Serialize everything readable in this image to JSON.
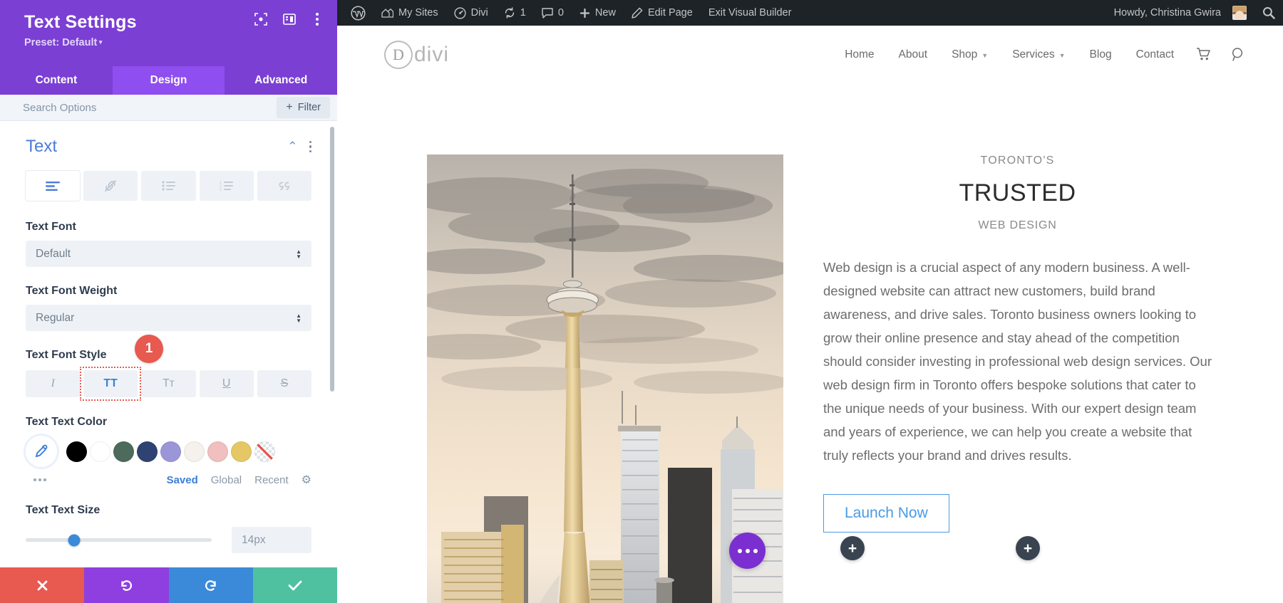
{
  "panel": {
    "title": "Text Settings",
    "preset_label": "Preset: Default",
    "header_icons": [
      "focus-frame-icon",
      "panel-layout-icon",
      "more-vertical-icon"
    ],
    "tabs": [
      {
        "label": "Content",
        "active": false
      },
      {
        "label": "Design",
        "active": true
      },
      {
        "label": "Advanced",
        "active": false
      }
    ],
    "search": {
      "placeholder": "Search Options",
      "value": ""
    },
    "filter_button": {
      "label": "Filter",
      "plus": "+"
    },
    "section": {
      "title": "Text",
      "toolbar": [
        {
          "name": "text-align-icon",
          "active": true
        },
        {
          "name": "link-icon",
          "active": false
        },
        {
          "name": "unordered-list-icon",
          "active": false
        },
        {
          "name": "ordered-list-icon",
          "active": false
        },
        {
          "name": "blockquote-icon",
          "active": false
        }
      ],
      "text_font": {
        "label": "Text Font",
        "value": "Default"
      },
      "text_font_weight": {
        "label": "Text Font Weight",
        "value": "Regular"
      },
      "text_font_style": {
        "label": "Text Font Style",
        "badge": "1",
        "options": [
          {
            "name": "italic-icon",
            "glyph": "I",
            "selected": false
          },
          {
            "name": "uppercase-icon",
            "glyph": "TT",
            "selected": true
          },
          {
            "name": "capitalize-icon",
            "glyph": "Tт",
            "selected": false
          },
          {
            "name": "underline-icon",
            "glyph": "U",
            "selected": false
          },
          {
            "name": "strikethrough-icon",
            "glyph": "S",
            "selected": false
          }
        ]
      },
      "text_text_color": {
        "label": "Text Text Color",
        "picker": "eyedropper-icon",
        "swatches": [
          "#000000",
          "#ffffff",
          "#4d6b5c",
          "#2e4372",
          "#9b96d8",
          "#f5f2ee",
          "#f0bfbf",
          "#e6c765",
          "transparent"
        ],
        "tabs": [
          {
            "label": "Saved",
            "active": true
          },
          {
            "label": "Global",
            "active": false
          },
          {
            "label": "Recent",
            "active": false
          }
        ],
        "settings_icon": "gear-icon"
      },
      "text_text_size": {
        "label": "Text Text Size",
        "value": "14px",
        "slider_percent": 26
      }
    },
    "actions": [
      {
        "name": "cancel-button",
        "icon": "close-icon",
        "color": "#e8594f"
      },
      {
        "name": "undo-button",
        "icon": "undo-icon",
        "color": "#8f3fe0"
      },
      {
        "name": "redo-button",
        "icon": "redo-icon",
        "color": "#3b8ad9"
      },
      {
        "name": "save-button",
        "icon": "check-icon",
        "color": "#4fc0a0"
      }
    ]
  },
  "wpbar": {
    "items": [
      {
        "label": "",
        "icon": "wordpress-logo-icon"
      },
      {
        "label": "My Sites",
        "icon": "sites-icon"
      },
      {
        "label": "Divi",
        "icon": "dashboard-icon"
      },
      {
        "label": "1",
        "icon": "updates-icon"
      },
      {
        "label": "0",
        "icon": "comments-icon"
      },
      {
        "label": "New",
        "icon": "plus-icon"
      },
      {
        "label": "Edit Page",
        "icon": "pencil-icon"
      },
      {
        "label": "Exit Visual Builder",
        "icon": ""
      }
    ],
    "howdy": "Howdy, Christina Gwira",
    "search_icon": "search-icon"
  },
  "sitenav": {
    "logo": {
      "mark": "D",
      "word": "divi"
    },
    "menu": [
      {
        "label": "Home",
        "caret": false
      },
      {
        "label": "About",
        "caret": false
      },
      {
        "label": "Shop",
        "caret": true
      },
      {
        "label": "Services",
        "caret": true
      },
      {
        "label": "Blog",
        "caret": false
      },
      {
        "label": "Contact",
        "caret": false
      }
    ],
    "cart_icon": "cart-icon",
    "search_icon": "search-icon"
  },
  "content": {
    "image_alt": "toronto-cn-tower-skyline-photo",
    "eyebrow": "TORONTO'S",
    "headline": "TRUSTED",
    "subline": "WEB DESIGN",
    "paragraph": "Web design is a crucial aspect of any modern business. A well-designed website can attract new customers, build brand awareness, and drive sales. Toronto business owners looking to grow their online presence and stay ahead of the competition should consider investing in professional web design services. Our web design firm in Toronto offers bespoke solutions that cater to the unique needs of your business. With our expert design team and years of experience, we can help you create a website that truly reflects your brand and drives results.",
    "cta_label": "Launch Now",
    "fab_label": "more-options",
    "add_buttons": [
      "+",
      "+"
    ]
  }
}
